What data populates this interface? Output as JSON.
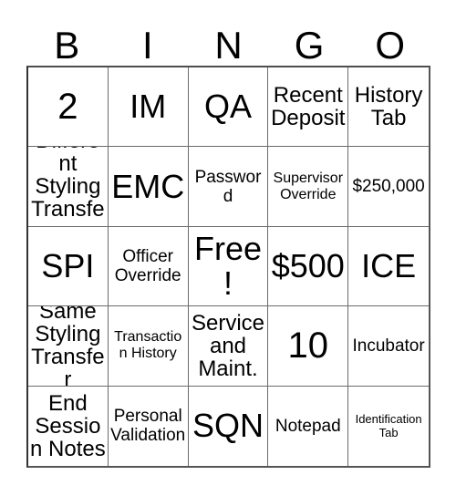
{
  "card": {
    "header_letters": [
      "B",
      "I",
      "N",
      "G",
      "O"
    ],
    "free_space_label": "Free!",
    "colors": {
      "background": "#ffffff",
      "text": "#000000",
      "grid_line": "#6b6b6b",
      "grid_border": "#333333"
    },
    "grid": {
      "columns": 5,
      "rows": 5,
      "cells": [
        {
          "text": "2",
          "size": "xxl"
        },
        {
          "text": "IM",
          "size": "xl"
        },
        {
          "text": "QA",
          "size": "xl"
        },
        {
          "text": "Recent Deposit",
          "size": "md"
        },
        {
          "text": "History Tab",
          "size": "md"
        },
        {
          "text": "Different Styling Transfer",
          "size": "md"
        },
        {
          "text": "EMC",
          "size": "xl"
        },
        {
          "text": "Password",
          "size": "sm"
        },
        {
          "text": "Supervisor Override",
          "size": "xs"
        },
        {
          "text": "$250,000",
          "size": "sm"
        },
        {
          "text": "SPI",
          "size": "xl"
        },
        {
          "text": "Officer Override",
          "size": "sm"
        },
        {
          "text": "Free!",
          "size": "xl"
        },
        {
          "text": "$500",
          "size": "xl"
        },
        {
          "text": "ICE",
          "size": "xl"
        },
        {
          "text": "Same Styling Transfer",
          "size": "md"
        },
        {
          "text": "Transaction History",
          "size": "xs"
        },
        {
          "text": "Service and Maint.",
          "size": "md"
        },
        {
          "text": "10",
          "size": "xxl"
        },
        {
          "text": "Incubator",
          "size": "sm"
        },
        {
          "text": "End Session Notes",
          "size": "md"
        },
        {
          "text": "Personal Validation",
          "size": "sm"
        },
        {
          "text": "SQN",
          "size": "xl"
        },
        {
          "text": "Notepad",
          "size": "sm"
        },
        {
          "text": "Identification Tab",
          "size": "xxs"
        }
      ]
    }
  }
}
